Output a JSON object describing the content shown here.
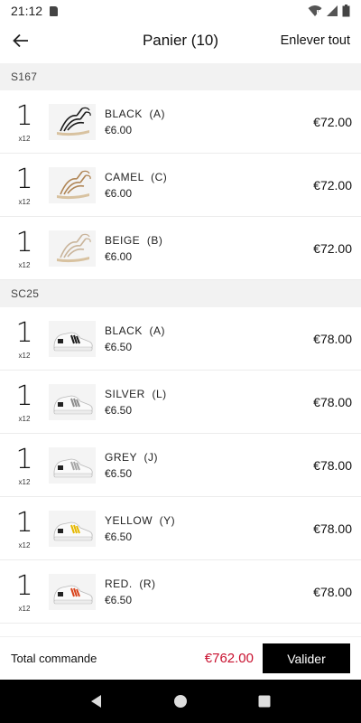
{
  "status_bar": {
    "time": "21:12",
    "icons": [
      "sd-card-icon",
      "wifi-off-icon",
      "signal-icon",
      "battery-icon"
    ]
  },
  "app_bar": {
    "title": "Panier (10)",
    "clear_label": "Enlever tout",
    "back_icon": "arrow-left-icon"
  },
  "sections": [
    {
      "name": "S167",
      "items": [
        {
          "qty": "1",
          "unit": "x12",
          "color": "BLACK  (A)",
          "unit_price": "€6.00",
          "line_total": "€72.00",
          "product": "sandal",
          "accent": "#1a1a1a"
        },
        {
          "qty": "1",
          "unit": "x12",
          "color": "CAMEL  (C)",
          "unit_price": "€6.00",
          "line_total": "€72.00",
          "product": "sandal",
          "accent": "#b08555"
        },
        {
          "qty": "1",
          "unit": "x12",
          "color": "BEIGE  (B)",
          "unit_price": "€6.00",
          "line_total": "€72.00",
          "product": "sandal",
          "accent": "#c9b49a"
        }
      ]
    },
    {
      "name": "SC25",
      "items": [
        {
          "qty": "1",
          "unit": "x12",
          "color": "BLACK  (A)",
          "unit_price": "€6.50",
          "line_total": "€78.00",
          "product": "sneaker",
          "accent": "#1a1a1a"
        },
        {
          "qty": "1",
          "unit": "x12",
          "color": "SILVER  (L)",
          "unit_price": "€6.50",
          "line_total": "€78.00",
          "product": "sneaker",
          "accent": "#8c8c8c"
        },
        {
          "qty": "1",
          "unit": "x12",
          "color": "GREY  (J)",
          "unit_price": "€6.50",
          "line_total": "€78.00",
          "product": "sneaker",
          "accent": "#a6a6a6"
        },
        {
          "qty": "1",
          "unit": "x12",
          "color": "YELLOW  (Y)",
          "unit_price": "€6.50",
          "line_total": "€78.00",
          "product": "sneaker",
          "accent": "#e6b800"
        },
        {
          "qty": "1",
          "unit": "x12",
          "color": "RED.  (R)",
          "unit_price": "€6.50",
          "line_total": "€78.00",
          "product": "sneaker",
          "accent": "#d9441c"
        }
      ]
    }
  ],
  "footer": {
    "total_label": "Total commande",
    "total_value": "€762.00",
    "validate_label": "Valider",
    "total_color": "#c8102e"
  },
  "nav_bar": {
    "icons": [
      "back-triangle-icon",
      "home-circle-icon",
      "recents-square-icon"
    ]
  }
}
